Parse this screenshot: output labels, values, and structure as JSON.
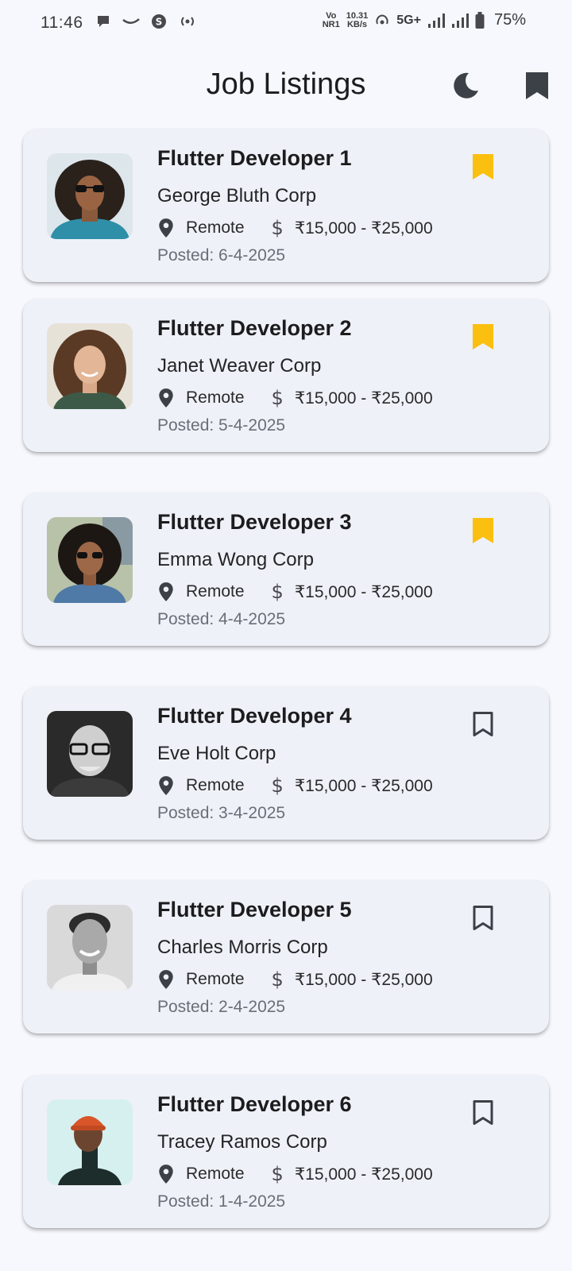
{
  "status_bar": {
    "time": "11:46",
    "volte": "Vo",
    "volte_sub": "NR1",
    "speed_value": "10.31",
    "speed_unit": "KB/s",
    "network": "5G+",
    "battery": "75%"
  },
  "app_bar": {
    "title": "Job Listings",
    "theme_icon": "moon-icon",
    "saved_icon": "bookmark-icon"
  },
  "colors": {
    "bookmark_active": "#fbbf0f",
    "card_background": "#eff1f8",
    "page_background": "#f7f8fd"
  },
  "jobs": [
    {
      "title": "Flutter Developer 1",
      "company": "George Bluth Corp",
      "location": "Remote",
      "currency_icon": "dollar-icon",
      "salary": "₹15,000 - ₹25,000",
      "posted": "Posted: 6-4-2025",
      "bookmarked": true
    },
    {
      "title": "Flutter Developer 2",
      "company": "Janet Weaver Corp",
      "location": "Remote",
      "currency_icon": "dollar-icon",
      "salary": "₹15,000 - ₹25,000",
      "posted": "Posted: 5-4-2025",
      "bookmarked": true
    },
    {
      "title": "Flutter Developer 3",
      "company": "Emma Wong Corp",
      "location": "Remote",
      "currency_icon": "dollar-icon",
      "salary": "₹15,000 - ₹25,000",
      "posted": "Posted: 4-4-2025",
      "bookmarked": true
    },
    {
      "title": "Flutter Developer 4",
      "company": "Eve Holt Corp",
      "location": "Remote",
      "currency_icon": "dollar-icon",
      "salary": "₹15,000 - ₹25,000",
      "posted": "Posted: 3-4-2025",
      "bookmarked": false
    },
    {
      "title": "Flutter Developer 5",
      "company": "Charles Morris Corp",
      "location": "Remote",
      "currency_icon": "dollar-icon",
      "salary": "₹15,000 - ₹25,000",
      "posted": "Posted: 2-4-2025",
      "bookmarked": false
    },
    {
      "title": "Flutter Developer 6",
      "company": "Tracey Ramos Corp",
      "location": "Remote",
      "currency_icon": "dollar-icon",
      "salary": "₹15,000 - ₹25,000",
      "posted": "Posted: 1-4-2025",
      "bookmarked": false
    }
  ]
}
